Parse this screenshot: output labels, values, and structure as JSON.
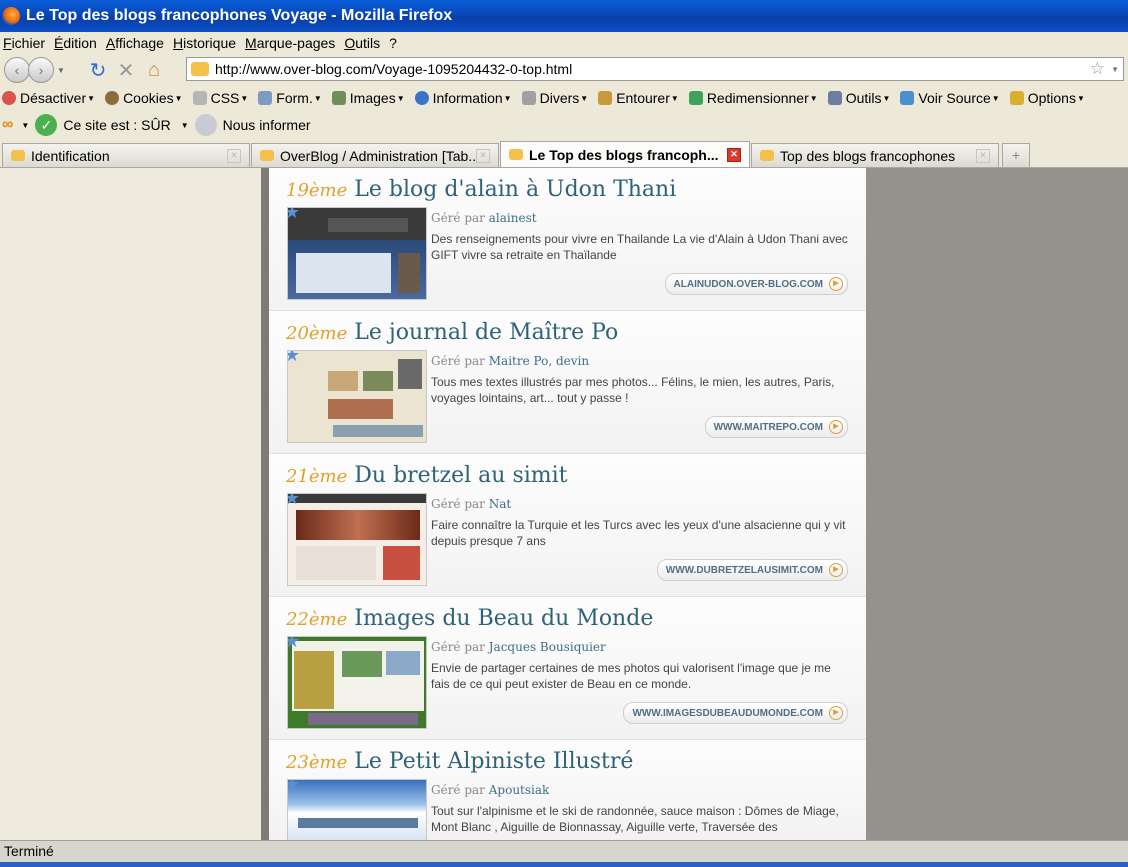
{
  "window": {
    "title": "Le Top des blogs francophones Voyage - Mozilla Firefox"
  },
  "menu": [
    "Fichier",
    "Édition",
    "Affichage",
    "Historique",
    "Marque-pages",
    "Outils",
    "?"
  ],
  "address": {
    "url": "http://www.over-blog.com/Voyage-1095204432-0-top.html"
  },
  "toolbar": [
    {
      "label": "Désactiver",
      "icon": "disable-icon",
      "color": "#d9534f"
    },
    {
      "label": "Cookies",
      "icon": "cookies-icon",
      "color": "#8a6d3b"
    },
    {
      "label": "CSS",
      "icon": "css-icon",
      "color": "#a9a9a9"
    },
    {
      "label": "Form.",
      "icon": "form-icon",
      "color": "#7d9cc0"
    },
    {
      "label": "Images",
      "icon": "images-icon",
      "color": "#6d8f5a"
    },
    {
      "label": "Information",
      "icon": "information-icon",
      "color": "#3b73c8"
    },
    {
      "label": "Divers",
      "icon": "misc-icon",
      "color": "#9a9a9a"
    },
    {
      "label": "Entourer",
      "icon": "outline-icon",
      "color": "#c89a3a"
    },
    {
      "label": "Redimensionner",
      "icon": "resize-icon",
      "color": "#3fa45a"
    },
    {
      "label": "Outils",
      "icon": "tools-icon",
      "color": "#6a7fa0"
    },
    {
      "label": "Voir Source",
      "icon": "source-icon",
      "color": "#4a90d0"
    },
    {
      "label": "Options",
      "icon": "options-icon",
      "color": "#d8b030"
    }
  ],
  "wot": {
    "status": "Ce site est : SÛR",
    "inform": "Nous informer"
  },
  "tabs": [
    {
      "label": "Identification"
    },
    {
      "label": "OverBlog / Administration [Tab..."
    },
    {
      "label": "Le Top des blogs francoph..."
    },
    {
      "label": "Top des blogs francophones"
    }
  ],
  "entries": [
    {
      "rank": "19ème",
      "title": "Le blog d'alain à Udon Thani",
      "managed_by": "Géré par",
      "user": "alainest",
      "desc": "Des renseignements pour vivre en Thailande La vie d'Alain à Udon Thani avec GIFT vivre sa retraite en Thaïlande",
      "site": "ALAINUDON.OVER-BLOG.COM"
    },
    {
      "rank": "20ème",
      "title": "Le journal de Maître Po",
      "managed_by": "Géré par",
      "user": "Maitre Po, devin",
      "desc": "Tous mes textes illustrés par mes photos... Félins, le mien, les autres, Paris, voyages lointains, art... tout y passe !",
      "site": "WWW.MAITREPO.COM"
    },
    {
      "rank": "21ème",
      "title": "Du bretzel au simit",
      "managed_by": "Géré par",
      "user": "Nat",
      "desc": "Faire connaître la Turquie et les Turcs avec les yeux d'une alsacienne qui y vit depuis presque 7 ans",
      "site": "WWW.DUBRETZELAUSIMIT.COM"
    },
    {
      "rank": "22ème",
      "title": "Images du Beau du Monde",
      "managed_by": "Géré par",
      "user": "Jacques Bousiquier",
      "desc": "Envie de partager certaines de mes photos qui valorisent l'image que je me fais de ce qui peut exister de Beau en ce monde.",
      "site": "WWW.IMAGESDUBEAUDUMONDE.COM"
    },
    {
      "rank": "23ème",
      "title": "Le Petit Alpiniste Illustré",
      "managed_by": "Géré par",
      "user": "Apoutsiak",
      "desc": "Tout sur l'alpinisme et le ski de randonnée, sauce maison : Dômes de Miage, Mont Blanc , Aiguille de Bionnassay, Aiguille verte, Traversée des",
      "site": ""
    }
  ],
  "status": {
    "text": "Terminé"
  }
}
